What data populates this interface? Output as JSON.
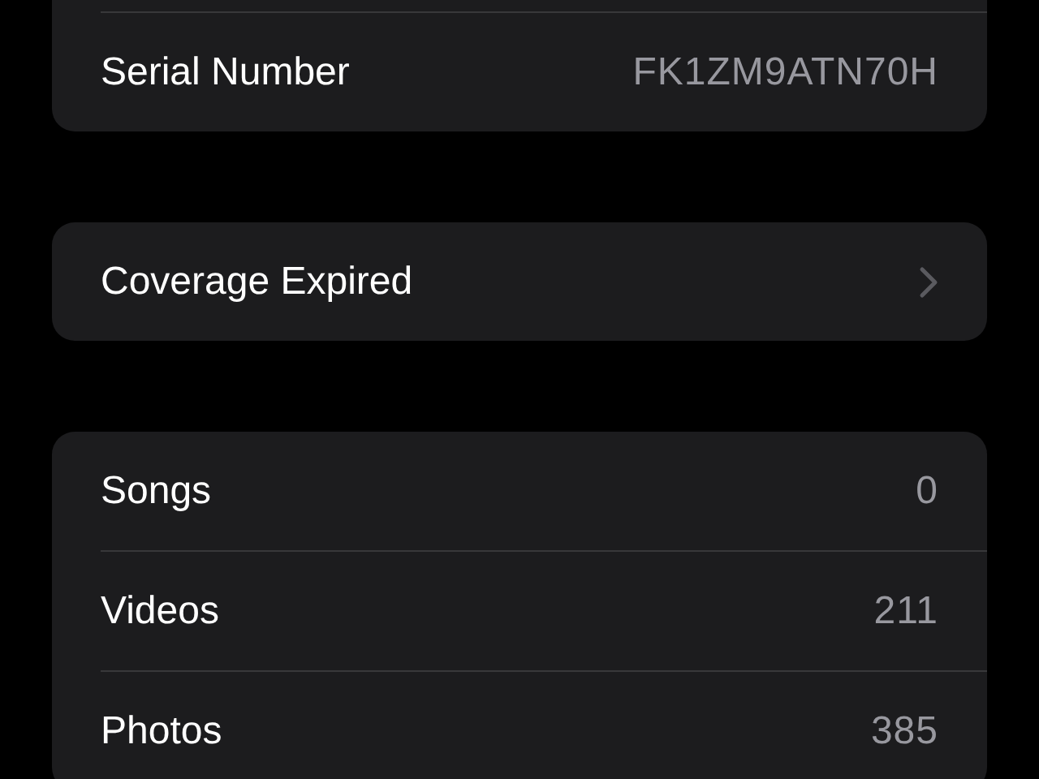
{
  "sections": [
    {
      "continued": true,
      "rows": [
        {
          "kind": "info",
          "label": "Serial Number",
          "value": "FK1ZM9ATN70H"
        }
      ]
    },
    {
      "continued": false,
      "rows": [
        {
          "kind": "link",
          "label": "Coverage Expired"
        }
      ]
    },
    {
      "continued": false,
      "rows": [
        {
          "kind": "info",
          "label": "Songs",
          "value": "0"
        },
        {
          "kind": "info",
          "label": "Videos",
          "value": "211"
        },
        {
          "kind": "info",
          "label": "Photos",
          "value": "385"
        }
      ]
    }
  ]
}
